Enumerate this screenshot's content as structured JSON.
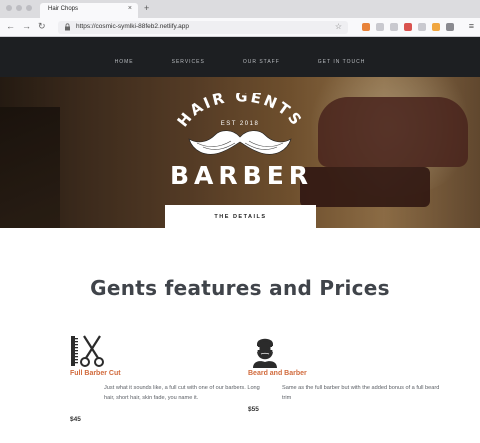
{
  "browser": {
    "tab_title": "Hair Chops",
    "tab_close": "×",
    "new_tab": "+",
    "url": "https://cosmic-symlki-88feb2.netlify.app",
    "back": "←",
    "forward": "→",
    "reload": "↻",
    "star": "☆",
    "menu": "≡"
  },
  "site": {
    "menu": [
      "HOME",
      "SERVICES",
      "OUR STAFF",
      "GET IN TOUCH"
    ],
    "logo": {
      "arc_text": "HAIR GENTS",
      "established": "EST 2018",
      "wordmark": "BARBER"
    },
    "details_tab": "THE DETAILS",
    "section_title": "Gents features and Prices",
    "features": [
      {
        "icon": "comb-scissors-icon",
        "name": "Full Barber Cut",
        "description": "Just what it sounds like, a full cut with one of our barbers. Long hair, short hair, skin fade, you name it.",
        "price": "$45"
      },
      {
        "icon": "bearded-man-icon",
        "name": "Beard and Barber",
        "description": "Same as the full barber but with the added bonus of a full beard trim",
        "price": "$55"
      }
    ]
  },
  "colors": {
    "accent": "#d16a3c",
    "header_bg": "#1d1f22",
    "title": "#40444a"
  }
}
